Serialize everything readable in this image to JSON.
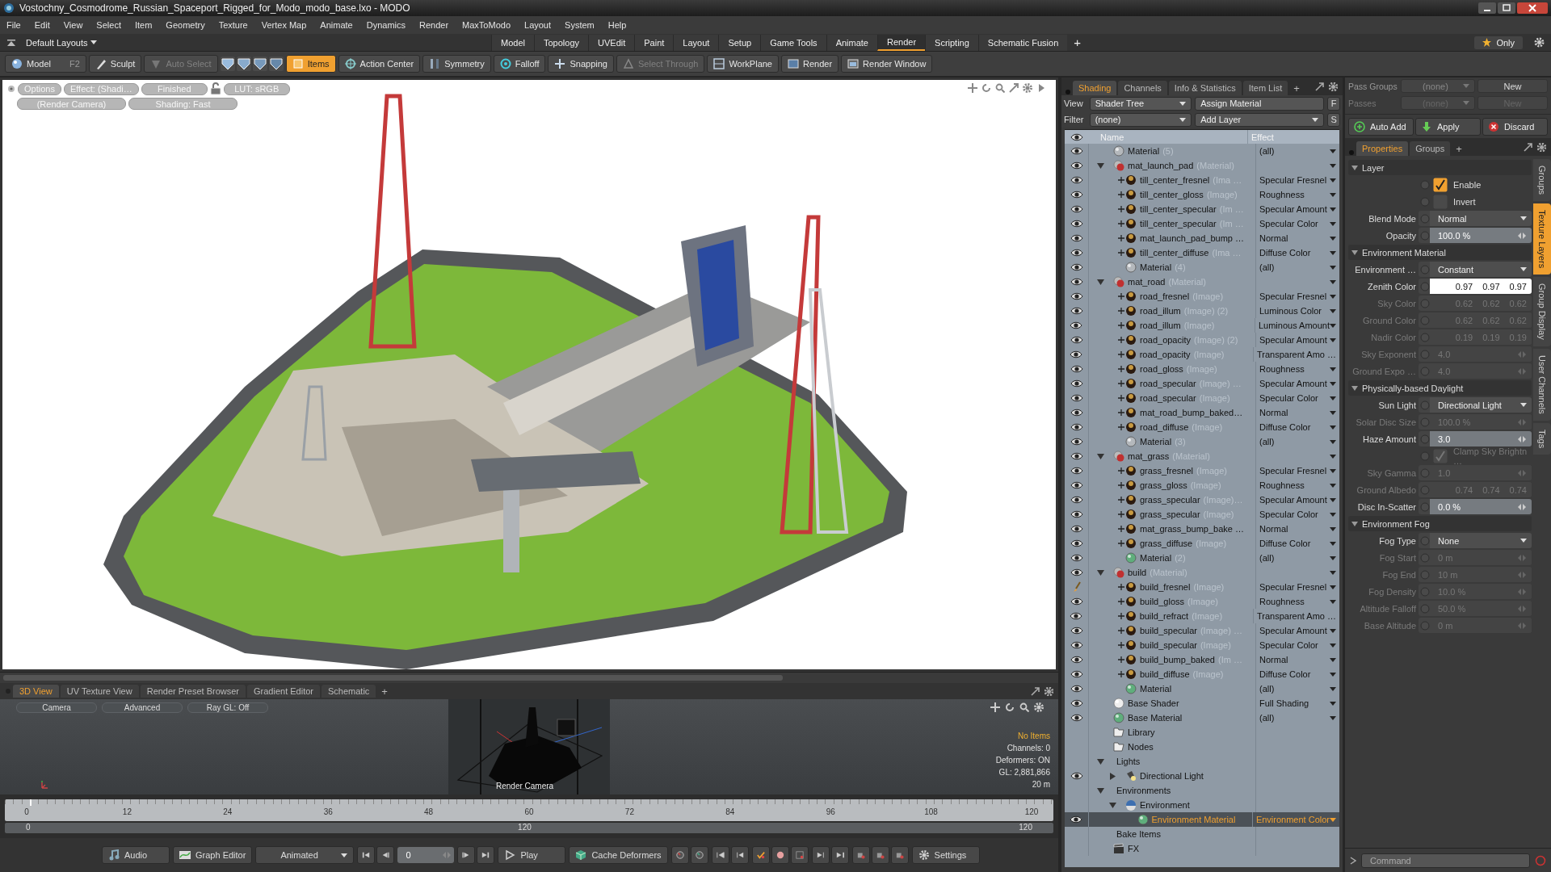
{
  "window": {
    "title": "Vostochny_Cosmodrome_Russian_Spaceport_Rigged_for_Modo_modo_base.lxo - MODO"
  },
  "menu": [
    "File",
    "Edit",
    "View",
    "Select",
    "Item",
    "Geometry",
    "Texture",
    "Vertex Map",
    "Animate",
    "Dynamics",
    "Render",
    "MaxToModo",
    "Layout",
    "System",
    "Help"
  ],
  "layouts": {
    "label": "Default Layouts",
    "add": "+",
    "only": "Only",
    "tabs": [
      {
        "label": "Model",
        "selected": false
      },
      {
        "label": "Topology",
        "selected": false
      },
      {
        "label": "UVEdit",
        "selected": false
      },
      {
        "label": "Paint",
        "selected": false
      },
      {
        "label": "Layout",
        "selected": false
      },
      {
        "label": "Setup",
        "selected": false
      },
      {
        "label": "Game Tools",
        "selected": false
      },
      {
        "label": "Animate",
        "selected": false
      },
      {
        "label": "Render",
        "selected": true
      },
      {
        "label": "Scripting",
        "selected": false
      },
      {
        "label": "Schematic Fusion",
        "selected": false
      }
    ]
  },
  "toolbar": [
    {
      "label": "Model",
      "shortcut": "F2",
      "selected": false,
      "disabled": false
    },
    {
      "label": "Sculpt",
      "selected": false,
      "disabled": false
    },
    {
      "label": "Auto Select",
      "selected": false,
      "disabled": true
    },
    {
      "label": "Items",
      "selected": true,
      "disabled": false
    },
    {
      "label": "Action Center",
      "selected": false,
      "disabled": false
    },
    {
      "label": "Symmetry",
      "selected": false,
      "disabled": false
    },
    {
      "label": "Falloff",
      "selected": false,
      "disabled": false
    },
    {
      "label": "Snapping",
      "selected": false,
      "disabled": false
    },
    {
      "label": "Select Through",
      "selected": false,
      "disabled": true
    },
    {
      "label": "WorkPlane",
      "selected": false,
      "disabled": false
    },
    {
      "label": "Render",
      "selected": false,
      "disabled": false
    },
    {
      "label": "Render Window",
      "selected": false,
      "disabled": false
    }
  ],
  "viewport": {
    "overlay": [
      [
        "Options",
        "Effect: (Shadi…",
        "Finished",
        "LUT: sRGB"
      ],
      [
        "(Render Camera)",
        "Shading: Fast"
      ]
    ]
  },
  "bottom_panel": {
    "add": "+",
    "tabs": [
      {
        "label": "3D View",
        "selected": true
      },
      {
        "label": "UV Texture View",
        "selected": false
      },
      {
        "label": "Render Preset Browser",
        "selected": false
      },
      {
        "label": "Gradient Editor",
        "selected": false
      },
      {
        "label": "Schematic",
        "selected": false
      }
    ],
    "buttons": [
      "Camera",
      "Advanced",
      "Ray GL: Off"
    ],
    "camera_label": "Render Camera",
    "info": [
      {
        "text": "No Items",
        "highlighted": true
      },
      {
        "text": "Channels: 0",
        "highlighted": false
      },
      {
        "text": "Deformers: ON",
        "highlighted": false
      },
      {
        "text": "GL: 2,881,866",
        "highlighted": false
      },
      {
        "text": "20 m",
        "highlighted": false
      }
    ]
  },
  "timeline": {
    "ticks": [
      "0",
      "12",
      "24",
      "36",
      "48",
      "60",
      "72",
      "84",
      "96",
      "108",
      "120"
    ],
    "range": [
      "0",
      "120",
      "120"
    ]
  },
  "transport": {
    "audio": "Audio",
    "graph_editor": "Graph Editor",
    "mode": "Animated",
    "frame": "0",
    "play": "Play",
    "cache": "Cache Deformers",
    "settings": "Settings"
  },
  "shading": {
    "add": "+",
    "tabs": [
      {
        "label": "Shading",
        "selected": true
      },
      {
        "label": "Channels",
        "selected": false
      },
      {
        "label": "Info & Statistics",
        "selected": false
      },
      {
        "label": "Item List",
        "selected": false
      }
    ],
    "view_label": "View",
    "view": "Shader Tree",
    "assign": "Assign Material",
    "f": "F",
    "filter_label": "Filter",
    "filter": "(none)",
    "add_layer": "Add Layer",
    "s": "S",
    "columns": [
      "Name",
      "Effect"
    ],
    "tree": [
      {
        "name": "Material",
        "type": "(5)",
        "effect": "(all)",
        "menu": true,
        "visible": true,
        "kind": "material",
        "color": "#b4b8bc",
        "selected": false
      },
      {
        "name": "mat_launch_pad",
        "type": "(Material)",
        "menu": true,
        "visible": true,
        "kind": "group",
        "expanded": true,
        "selected": false,
        "children": [
          {
            "name": "till_center_fresnel",
            "type": "(Ima …",
            "effect": "Specular Fresnel",
            "menu": true,
            "visible": true,
            "selected": false
          },
          {
            "name": "till_center_gloss",
            "type": "(Image)",
            "effect": "Roughness",
            "menu": true,
            "visible": true,
            "selected": false
          },
          {
            "name": "till_center_specular",
            "type": "(Im …",
            "effect": "Specular Amount",
            "menu": true,
            "visible": true,
            "selected": false
          },
          {
            "name": "till_center_specular",
            "type": "(Im …",
            "effect": "Specular Color",
            "menu": true,
            "visible": true,
            "selected": false
          },
          {
            "name": "mat_launch_pad_bump …",
            "effect": "Normal",
            "menu": true,
            "visible": true,
            "selected": false
          },
          {
            "name": "till_center_diffuse",
            "type": "(Ima …",
            "effect": "Diffuse Color",
            "menu": true,
            "visible": true,
            "selected": false
          },
          {
            "name": "Material",
            "type": "(4)",
            "effect": "(all)",
            "menu": true,
            "visible": true,
            "kind": "material",
            "color": "#b4b8bc",
            "selected": false
          }
        ]
      },
      {
        "name": "mat_road",
        "type": "(Material)",
        "menu": true,
        "visible": true,
        "kind": "group",
        "expanded": true,
        "selected": false,
        "children": [
          {
            "name": "road_fresnel",
            "type": "(Image)",
            "effect": "Specular Fresnel",
            "menu": true,
            "visible": true,
            "selected": false
          },
          {
            "name": "road_illum",
            "type": "(Image) (2)",
            "effect": "Luminous Color",
            "menu": true,
            "visible": true,
            "selected": false
          },
          {
            "name": "road_illum",
            "type": "(Image)",
            "effect": "Luminous Amount",
            "menu": true,
            "visible": true,
            "selected": false
          },
          {
            "name": "road_opacity",
            "type": "(Image) (2)",
            "effect": "Specular Amount",
            "menu": true,
            "visible": true,
            "selected": false
          },
          {
            "name": "road_opacity",
            "type": "(Image)",
            "effect": "Transparent Amo …",
            "menu": false,
            "visible": true,
            "selected": false
          },
          {
            "name": "road_gloss",
            "type": "(Image)",
            "effect": "Roughness",
            "menu": true,
            "visible": true,
            "selected": false
          },
          {
            "name": "road_specular",
            "type": "(Image) …",
            "effect": "Specular Amount",
            "menu": true,
            "visible": true,
            "selected": false
          },
          {
            "name": "road_specular",
            "type": "(Image)",
            "effect": "Specular Color",
            "menu": true,
            "visible": true,
            "selected": false
          },
          {
            "name": "mat_road_bump_baked…",
            "effect": "Normal",
            "menu": true,
            "visible": true,
            "selected": false
          },
          {
            "name": "road_diffuse",
            "type": "(Image)",
            "effect": "Diffuse Color",
            "menu": true,
            "visible": true,
            "selected": false
          },
          {
            "name": "Material",
            "type": "(3)",
            "effect": "(all)",
            "menu": true,
            "visible": true,
            "kind": "material",
            "color": "#b4b8bc",
            "selected": false
          }
        ]
      },
      {
        "name": "mat_grass",
        "type": "(Material)",
        "menu": true,
        "visible": true,
        "kind": "group",
        "expanded": true,
        "selected": false,
        "children": [
          {
            "name": "grass_fresnel",
            "type": "(Image)",
            "effect": "Specular Fresnel",
            "menu": true,
            "visible": true,
            "selected": false
          },
          {
            "name": "grass_gloss",
            "type": "(Image)",
            "effect": "Roughness",
            "menu": true,
            "visible": true,
            "selected": false
          },
          {
            "name": "grass_specular",
            "type": "(Image)…",
            "effect": "Specular Amount",
            "menu": true,
            "visible": true,
            "selected": false
          },
          {
            "name": "grass_specular",
            "type": "(Image)",
            "effect": "Specular Color",
            "menu": true,
            "visible": true,
            "selected": false
          },
          {
            "name": "mat_grass_bump_bake …",
            "effect": "Normal",
            "menu": true,
            "visible": true,
            "selected": false
          },
          {
            "name": "grass_diffuse",
            "type": "(Image)",
            "effect": "Diffuse Color",
            "menu": true,
            "visible": true,
            "selected": false
          },
          {
            "name": "Material",
            "type": "(2)",
            "effect": "(all)",
            "menu": true,
            "visible": true,
            "kind": "material",
            "color": "#5fae7c",
            "selected": false
          }
        ]
      },
      {
        "name": "build",
        "type": "(Material)",
        "menu": true,
        "visible": true,
        "kind": "group",
        "expanded": true,
        "selected": false,
        "children": [
          {
            "name": "build_fresnel",
            "type": "(Image)",
            "effect": "Specular Fresnel",
            "menu": true,
            "visible": true,
            "painting": true,
            "selected": false
          },
          {
            "name": "build_gloss",
            "type": "(Image)",
            "effect": "Roughness",
            "menu": true,
            "visible": true,
            "selected": false
          },
          {
            "name": "build_refract",
            "type": "(Image)",
            "effect": "Transparent Amo …",
            "menu": false,
            "visible": true,
            "selected": false
          },
          {
            "name": "build_specular",
            "type": "(Image) …",
            "effect": "Specular Amount",
            "menu": true,
            "visible": true,
            "selected": false
          },
          {
            "name": "build_specular",
            "type": "(Image)",
            "effect": "Specular Color",
            "menu": true,
            "visible": true,
            "selected": false
          },
          {
            "name": "build_bump_baked",
            "type": "(Im …",
            "effect": "Normal",
            "menu": true,
            "visible": true,
            "selected": false
          },
          {
            "name": "build_diffuse",
            "type": "(Image)",
            "effect": "Diffuse Color",
            "menu": true,
            "visible": true,
            "selected": false
          },
          {
            "name": "Material",
            "effect": "(all)",
            "menu": true,
            "visible": true,
            "kind": "material",
            "color": "#5fae7c",
            "selected": false
          }
        ]
      },
      {
        "name": "Base Shader",
        "effect": "Full Shading",
        "menu": true,
        "visible": true,
        "kind": "shader",
        "selected": false
      },
      {
        "name": "Base Material",
        "effect": "(all)",
        "menu": true,
        "visible": true,
        "kind": "material",
        "color": "#5fae7c",
        "selected": false
      },
      {
        "name": "Library",
        "menu": false,
        "visible": false,
        "kind": "folder",
        "selected": false
      },
      {
        "name": "Nodes",
        "menu": false,
        "visible": false,
        "kind": "folder",
        "selected": false
      },
      {
        "name": "Lights",
        "menu": false,
        "visible": false,
        "kind": "plain",
        "expanded": true,
        "selected": false,
        "children": [
          {
            "name": "Directional Light",
            "menu": false,
            "visible": true,
            "kind": "light",
            "expanded": false,
            "selected": false
          }
        ]
      },
      {
        "name": "Environments",
        "menu": false,
        "visible": false,
        "kind": "plain",
        "expanded": true,
        "selected": false,
        "children": [
          {
            "name": "Environment",
            "menu": false,
            "visible": false,
            "kind": "environment",
            "expanded": true,
            "selected": false,
            "children": [
              {
                "name": "Environment Material",
                "effect": "Environment Color",
                "menu": true,
                "visible": true,
                "kind": "material",
                "color": "#5fae7c",
                "selected": true
              }
            ]
          }
        ]
      },
      {
        "name": "Bake Items",
        "menu": false,
        "visible": false,
        "kind": "plain",
        "selected": false
      },
      {
        "name": "FX",
        "menu": false,
        "visible": false,
        "kind": "fx",
        "selected": false
      }
    ]
  },
  "properties": {
    "pass_groups_label": "Pass Groups",
    "pass_groups": "(none)",
    "new_group": "New",
    "passes_label": "Passes",
    "passes": "(none)",
    "new_pass": "New",
    "actions": [
      "Auto Add",
      "Apply",
      "Discard"
    ],
    "add": "+",
    "tabs": [
      {
        "label": "Properties",
        "selected": true
      },
      {
        "label": "Groups",
        "selected": false
      }
    ],
    "side_tabs": [
      {
        "label": "Groups",
        "selected": false
      },
      {
        "label": "Texture Layers",
        "selected": true
      },
      {
        "label": "Group Display",
        "selected": false
      },
      {
        "label": "User Channels",
        "selected": false
      },
      {
        "label": "Tags",
        "selected": false
      }
    ],
    "sections": [
      {
        "title": "Layer",
        "expanded": true,
        "rows": [
          {
            "label": "Enable",
            "kind": "check",
            "checked": true,
            "disabled": false,
            "focused": false
          },
          {
            "label": "Invert",
            "kind": "check",
            "checked": false,
            "disabled": false,
            "focused": false
          },
          {
            "label": "Blend Mode",
            "kind": "dropdown",
            "value": "Normal",
            "disabled": false,
            "focused": false
          },
          {
            "label": "Opacity",
            "kind": "slider",
            "value": "100.0 %",
            "disabled": false,
            "focused": false
          }
        ]
      },
      {
        "title": "Environment Material",
        "expanded": true,
        "rows": [
          {
            "label": "Environment …",
            "kind": "dropdown",
            "value": "Constant",
            "disabled": false,
            "focused": false
          },
          {
            "label": "Zenith Color",
            "kind": "color",
            "values": [
              "0.97",
              "0.97",
              "0.97"
            ],
            "disabled": false,
            "focused": true
          },
          {
            "label": "Sky Color",
            "kind": "color",
            "values": [
              "0.62",
              "0.62",
              "0.62"
            ],
            "disabled": true,
            "focused": false
          },
          {
            "label": "Ground Color",
            "kind": "color",
            "values": [
              "0.62",
              "0.62",
              "0.62"
            ],
            "disabled": true,
            "focused": false
          },
          {
            "label": "Nadir Color",
            "kind": "color",
            "values": [
              "0.19",
              "0.19",
              "0.19"
            ],
            "disabled": true,
            "focused": false
          },
          {
            "label": "Sky Exponent",
            "kind": "slider",
            "value": "4.0",
            "disabled": true,
            "focused": false
          },
          {
            "label": "Ground Expo …",
            "kind": "slider",
            "value": "4.0",
            "disabled": true,
            "focused": false
          }
        ]
      },
      {
        "title": "Physically-based Daylight",
        "expanded": true,
        "rows": [
          {
            "label": "Sun Light",
            "kind": "dropdown",
            "value": "Directional Light",
            "disabled": false,
            "focused": false
          },
          {
            "label": "Solar Disc Size",
            "kind": "slider",
            "value": "100.0 %",
            "disabled": true,
            "focused": false
          },
          {
            "label": "Haze Amount",
            "kind": "slider",
            "value": "3.0",
            "disabled": false,
            "focused": false
          },
          {
            "label": "Clamp Sky Brightn …",
            "kind": "check",
            "checked": true,
            "disabled": true,
            "focused": false
          },
          {
            "label": "Sky Gamma",
            "kind": "slider",
            "value": "1.0",
            "disabled": true,
            "focused": false
          },
          {
            "label": "Ground Albedo",
            "kind": "color",
            "values": [
              "0.74",
              "0.74",
              "0.74"
            ],
            "disabled": true,
            "focused": false
          },
          {
            "label": "Disc In-Scatter",
            "kind": "slider",
            "value": "0.0 %",
            "disabled": false,
            "focused": false
          }
        ]
      },
      {
        "title": "Environment Fog",
        "expanded": true,
        "rows": [
          {
            "label": "Fog Type",
            "kind": "dropdown",
            "value": "None",
            "disabled": false,
            "focused": false
          },
          {
            "label": "Fog Start",
            "kind": "slider",
            "value": "0 m",
            "disabled": true,
            "focused": false
          },
          {
            "label": "Fog End",
            "kind": "slider",
            "value": "10 m",
            "disabled": true,
            "focused": false
          },
          {
            "label": "Fog Density",
            "kind": "slider",
            "value": "10.0 %",
            "disabled": true,
            "focused": false
          },
          {
            "label": "Altitude Falloff",
            "kind": "slider",
            "value": "50.0 %",
            "disabled": true,
            "focused": false
          },
          {
            "label": "Base Altitude",
            "kind": "slider",
            "value": "0 m",
            "disabled": true,
            "focused": false
          }
        ]
      }
    ],
    "command": {
      "placeholder": "Command"
    }
  }
}
